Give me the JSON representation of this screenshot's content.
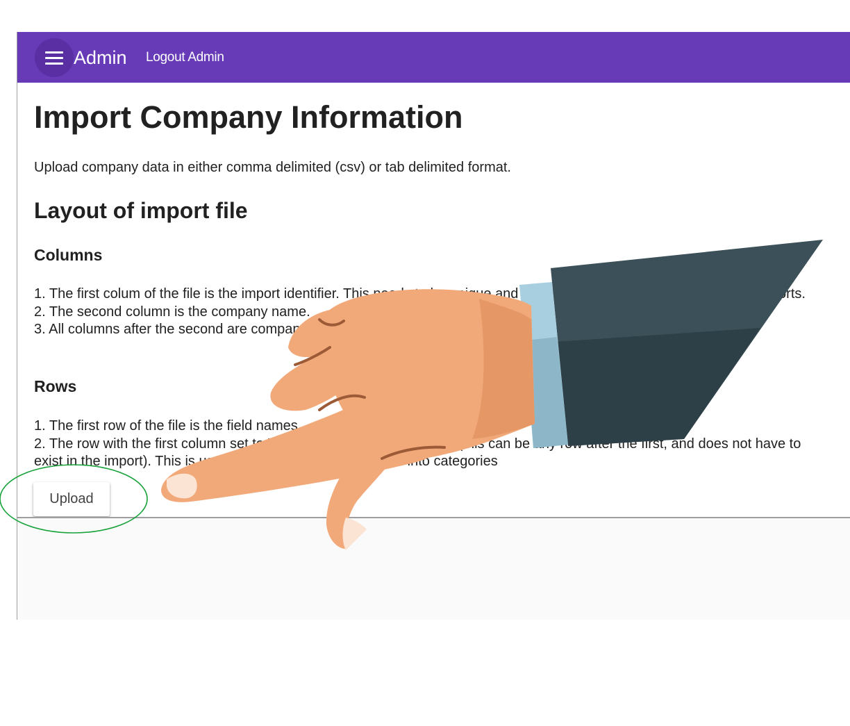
{
  "appbar": {
    "title": "Admin",
    "logout_label": "Logout Admin",
    "color": "#673ab7",
    "menu_icon": "hamburger-menu-icon"
  },
  "page": {
    "title": "Import Company Information",
    "intro": "Upload company data in either comma delimited (csv) or tab delimited format.",
    "layout_heading": "Layout of import file",
    "columns_heading": "Columns",
    "columns_items": [
      "1. The first colum of the file is the import identifier. This needs to be unique and is used to match the company in later imports.",
      "2. The second column is the company name.",
      "3. All columns after the second are company fields."
    ],
    "rows_heading": "Rows",
    "rows_items": [
      "1. The first row of the file is the field names.",
      "2. The row with the first column set to \"Category\" is the category row (this can be any row after the first, and does not have to exist in the import). This is used to group the company fields into categories"
    ],
    "upload_label": "Upload"
  },
  "annotation": {
    "highlight_color": "#1aa33c",
    "pointer": "pointing-hand-illustration"
  }
}
